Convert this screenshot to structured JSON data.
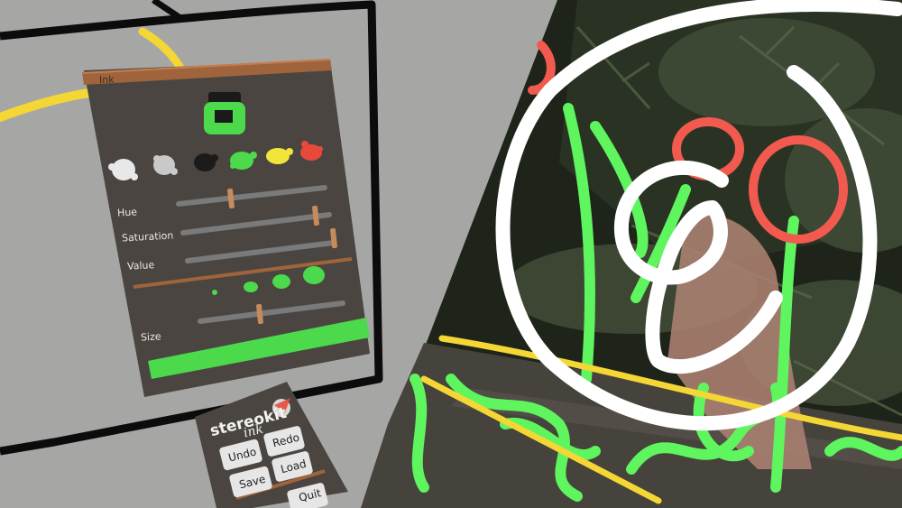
{
  "ink_panel": {
    "title": "Ink",
    "labels": {
      "hue": "Hue",
      "saturation": "Saturation",
      "value": "Value",
      "size": "Size"
    },
    "slider_levels": {
      "hue": 0.37,
      "saturation": 0.93,
      "value": 0.98,
      "size": 0.42
    },
    "swatches": [
      "white",
      "light-grey",
      "black",
      "green",
      "yellow",
      "red"
    ],
    "selected_color": "#4cd94c",
    "accent_colors": {
      "frame": "#8a5a3a",
      "selected": "#4cd94c"
    }
  },
  "app_menu": {
    "brand_line1": "stereokit",
    "brand_line2": "ink",
    "buttons": {
      "undo": "Undo",
      "redo": "Redo",
      "save": "Save",
      "load": "Load",
      "quit": "Quit"
    }
  }
}
